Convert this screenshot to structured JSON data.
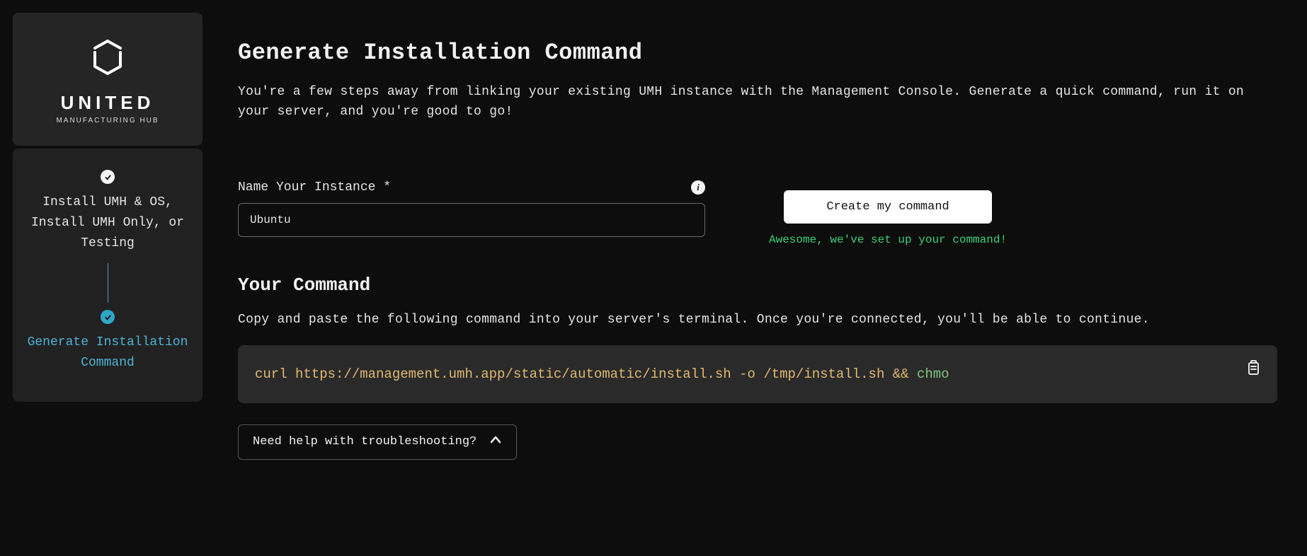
{
  "logo": {
    "title": "UNITED",
    "subtitle": "MANUFACTURING HUB"
  },
  "steps": [
    {
      "label": "Install UMH & OS, Install UMH Only, or Testing",
      "state": "done"
    },
    {
      "label": "Generate Installation Command",
      "state": "current"
    }
  ],
  "page": {
    "title": "Generate Installation Command",
    "intro": "You're a few steps away from linking your existing UMH instance with the Management Console. Generate a quick command, run it on your server, and you're good to go!"
  },
  "form": {
    "instance_label": "Name Your Instance *",
    "instance_value": "Ubuntu",
    "create_button": "Create my command",
    "success_message": "Awesome, we've set up your command!"
  },
  "command_section": {
    "title": "Your Command",
    "description": "Copy and paste the following command into your server's terminal. Once you're connected, you'll be able to continue.",
    "command_main": "curl https://management.umh.app/static/automatic/install.sh -o /tmp/install.sh && ",
    "command_extra": "chmo"
  },
  "help": {
    "toggle_label": "Need help with troubleshooting?"
  },
  "icons": {
    "info_glyph": "i"
  }
}
